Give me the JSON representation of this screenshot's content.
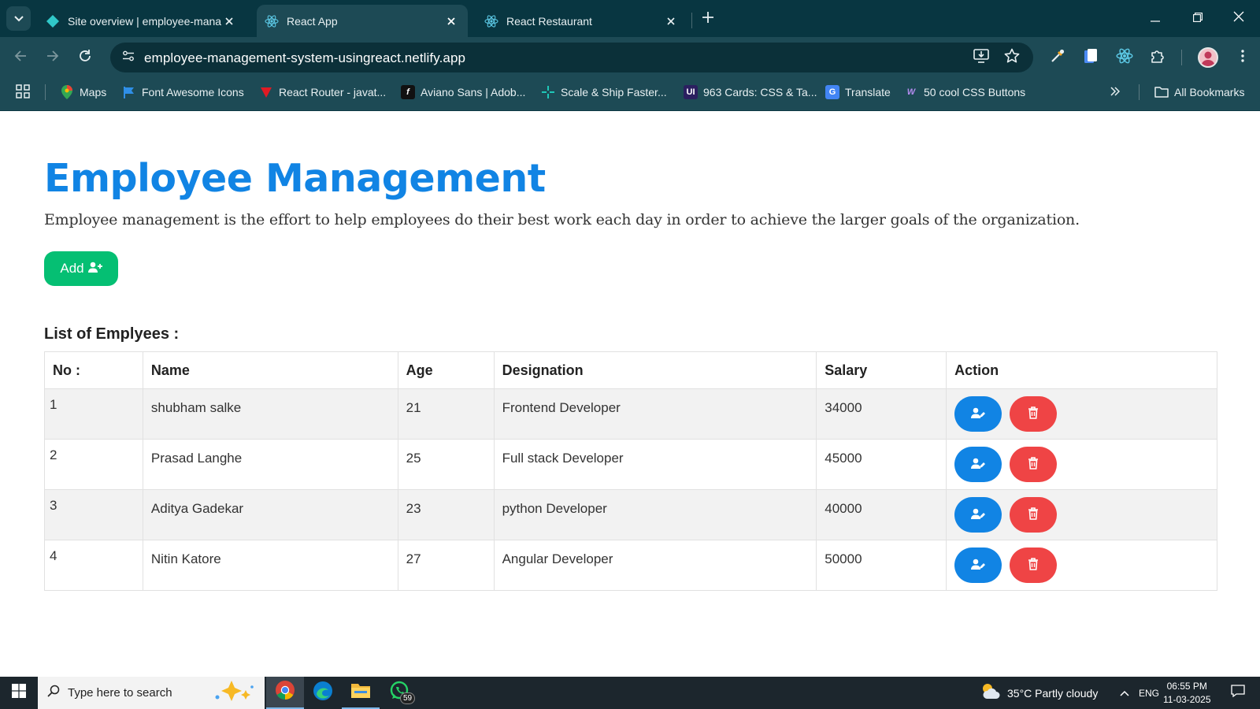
{
  "browser": {
    "tabs": [
      {
        "title": "Site overview | employee-mana",
        "active": false,
        "favicon": "netlify-icon"
      },
      {
        "title": "React App",
        "active": true,
        "favicon": "react-icon"
      },
      {
        "title": "React Restaurant",
        "active": false,
        "favicon": "react-icon"
      }
    ],
    "url": "employee-management-system-usingreact.netlify.app",
    "bookmarks": [
      {
        "label": "Maps",
        "icon": "maps-icon"
      },
      {
        "label": "Font Awesome Icons",
        "icon": "flag-icon"
      },
      {
        "label": "React Router - javat...",
        "icon": "javatpoint-icon"
      },
      {
        "label": "Aviano Sans | Adob...",
        "icon": "adobe-fonts-icon"
      },
      {
        "label": "Scale & Ship Faster...",
        "icon": "sparkle-icon"
      },
      {
        "label": "963 Cards: CSS & Ta...",
        "icon": "uiverse-icon"
      },
      {
        "label": "Translate",
        "icon": "translate-icon"
      },
      {
        "label": "50 cool CSS Buttons",
        "icon": "css-buttons-icon"
      }
    ],
    "all_bookmarks": "All Bookmarks"
  },
  "page": {
    "title": "Employee Management",
    "description": "Employee management is the effort to help employees do their best work each day in order to achieve the larger goals of the organization.",
    "add_button": "Add",
    "list_title": "List of Emplyees :",
    "columns": [
      "No :",
      "Name",
      "Age",
      "Designation",
      "Salary",
      "Action"
    ],
    "employees": [
      {
        "no": "1",
        "name": "shubham salke",
        "age": "21",
        "designation": "Frontend Developer",
        "salary": "34000"
      },
      {
        "no": "2",
        "name": "Prasad Langhe",
        "age": "25",
        "designation": "Full stack Developer",
        "salary": "45000"
      },
      {
        "no": "3",
        "name": "Aditya Gadekar",
        "age": "23",
        "designation": "python Developer",
        "salary": "40000"
      },
      {
        "no": "4",
        "name": "Nitin Katore",
        "age": "27",
        "designation": "Angular Developer",
        "salary": "50000"
      }
    ],
    "colors": {
      "accent": "#1184e4",
      "add": "#05bf73",
      "delete": "#ef4445"
    }
  },
  "taskbar": {
    "search_placeholder": "Type here to search",
    "whatsapp_badge": "59",
    "weather": "35°C  Partly cloudy",
    "language": "ENG",
    "time": "06:55 PM",
    "date": "11-03-2025"
  }
}
